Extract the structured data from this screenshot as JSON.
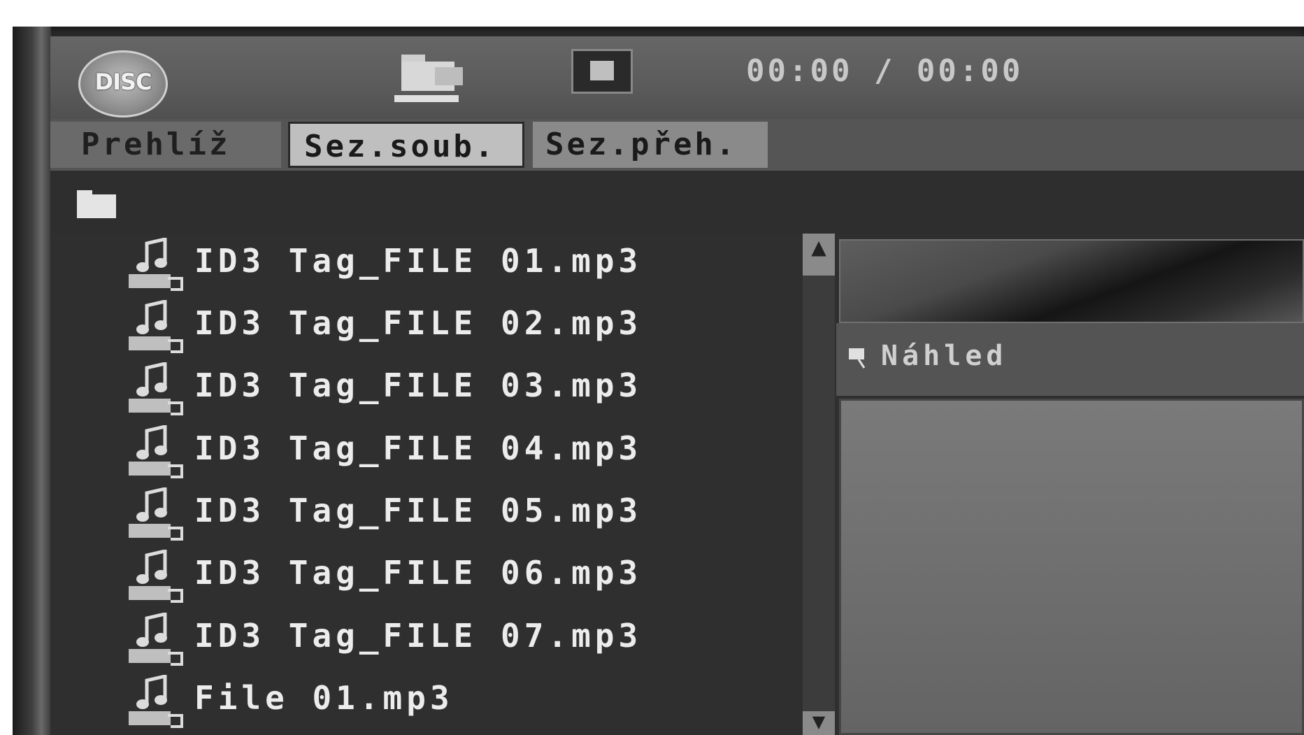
{
  "header": {
    "disc_logo_text": "DISC",
    "time": "00:00 / 00:00"
  },
  "tabs": [
    {
      "label": "Prehlíž"
    },
    {
      "label": "Sez.soub."
    },
    {
      "label": "Sez.přeh."
    }
  ],
  "file_list": [
    {
      "name": "ID3 Tag_FILE 01.mp3"
    },
    {
      "name": "ID3 Tag_FILE 02.mp3"
    },
    {
      "name": "ID3 Tag_FILE 03.mp3"
    },
    {
      "name": "ID3 Tag_FILE 04.mp3"
    },
    {
      "name": "ID3 Tag_FILE 05.mp3"
    },
    {
      "name": "ID3 Tag_FILE 06.mp3"
    },
    {
      "name": "ID3 Tag_FILE 07.mp3"
    },
    {
      "name": "File 01.mp3"
    }
  ],
  "preview": {
    "label": "Náhled"
  },
  "icons": {
    "disc": "disc-logo-icon",
    "folder_mode": "folder-icon",
    "stop": "stop-icon",
    "root_folder": "folder-icon",
    "file": "mp3-file-icon",
    "preview": "preview-icon",
    "scroll_up": "▲",
    "scroll_down": "▼"
  },
  "colors": {
    "background": "#2b2b2b",
    "header": "#5b5b5b",
    "active_tab": "#bfbfbf",
    "text": "#ececec"
  }
}
